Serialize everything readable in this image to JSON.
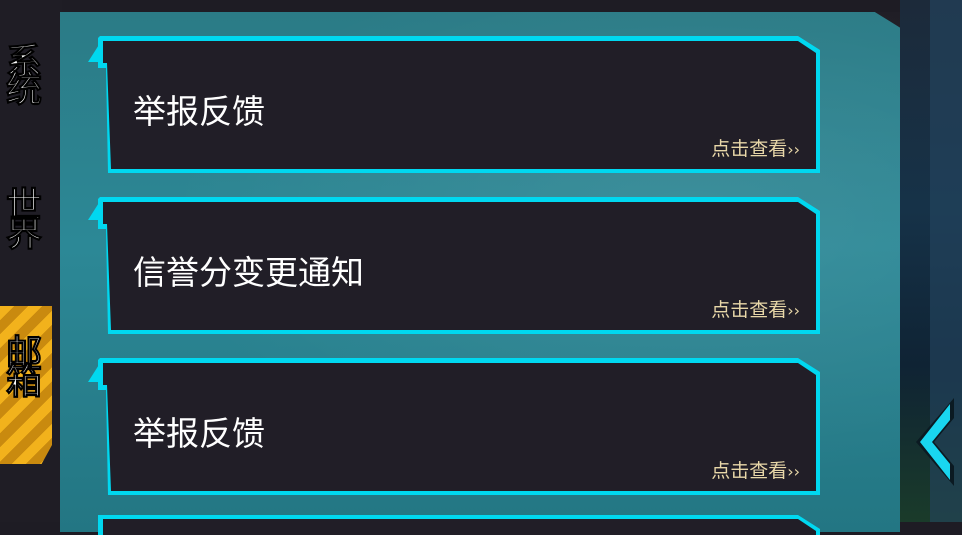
{
  "sidebar": {
    "tabs": [
      {
        "label": "系统",
        "active": false
      },
      {
        "label": "世界",
        "active": false
      },
      {
        "label": "邮箱",
        "active": true
      }
    ]
  },
  "mail": {
    "items": [
      {
        "title": "举报反馈",
        "action": "点击查看",
        "chevron": "››"
      },
      {
        "title": "信誉分变更通知",
        "action": "点击查看",
        "chevron": "››"
      },
      {
        "title": "举报反馈",
        "action": "点击查看",
        "chevron": "››"
      }
    ]
  },
  "colors": {
    "card_border": "#00d8f0",
    "card_bg": "#211e27",
    "panel_bg": "#2c8896",
    "action_text": "#e8d7a8",
    "active_tab": "#f2b21c"
  },
  "icons": {
    "back": "chevron-left-icon"
  }
}
